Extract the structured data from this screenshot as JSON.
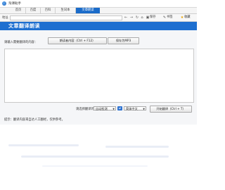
{
  "app": {
    "title": "淘课助手"
  },
  "tabs": [
    {
      "label": "首页"
    },
    {
      "label": "百度"
    },
    {
      "label": "百科"
    },
    {
      "label": "生词本"
    },
    {
      "label": "文章朗读"
    }
  ],
  "address_bar": {
    "label": "地址",
    "value": "",
    "save_label": "保存",
    "bookmark_label": "书签",
    "favorite_label": "收藏"
  },
  "page": {
    "banner_title": "文章翻译朗读",
    "input_prompt": "请输入需要翻译的内容：",
    "read_button": "朗读者内容（Ctrl + F12）",
    "save_mp3_button": "保存为MP3",
    "language_label": "请选择翻译的语言：",
    "source_language": "自动检测",
    "target_language": "简体中文",
    "translate_button": "开始翻译（Ctrl + T）",
    "tip": "提示：翻译内容来自达人工翻经，仅供参考。"
  },
  "colors": {
    "accent": "#1e6fd0",
    "active_tab": "#1a6bc9"
  },
  "icons": {
    "app": "app-logo-icon",
    "back": "back-arrow-icon",
    "forward": "forward-arrow-icon",
    "refresh": "refresh-icon",
    "home": "home-icon",
    "save": "save-icon",
    "bookmark": "bookmark-icon",
    "favorite": "star-icon",
    "swap": "swap-icon"
  }
}
